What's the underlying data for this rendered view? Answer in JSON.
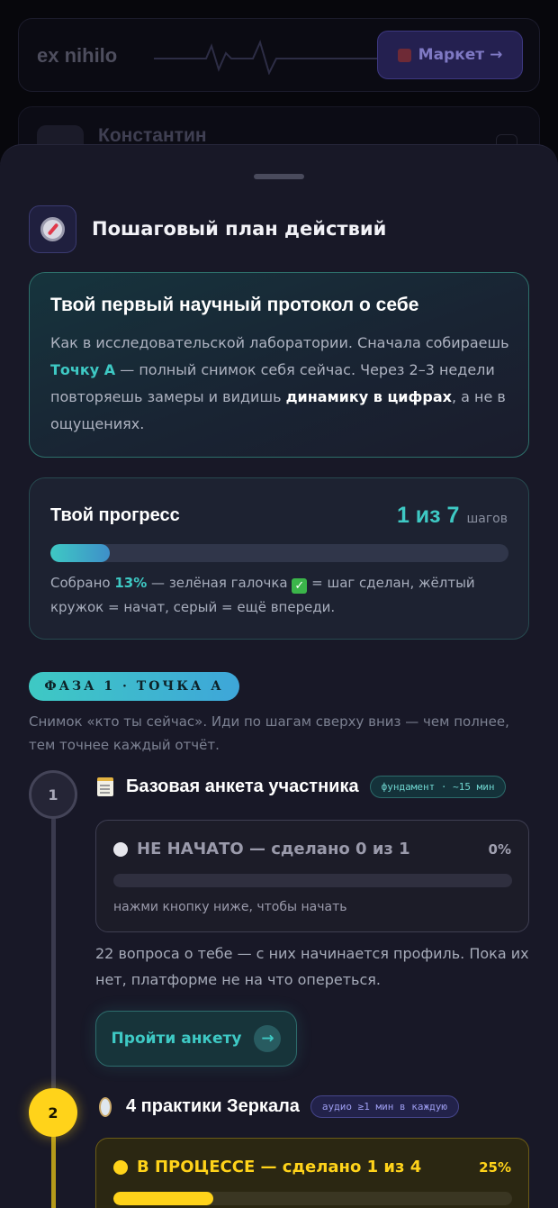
{
  "header": {
    "brand": "ex nihilo",
    "market_label": "Маркет →"
  },
  "profile": {
    "name": "Константин"
  },
  "sheet": {
    "title": "Пошаговый план действий",
    "intro": {
      "title": "Твой первый научный протокол о себе",
      "text_1": "Как в исследовательской лаборатории. Сначала собираешь ",
      "hl_1": "Точку А",
      "text_2": " — полный снимок себя сейчас. Через 2–3 недели повторяешь замеры и видишь ",
      "hl_2": "динамику в цифрах",
      "text_3": ", а не в ощущениях."
    },
    "progress": {
      "title": "Твой прогресс",
      "count": "1 из 7",
      "count_unit": "шагов",
      "fraction": 0.13,
      "note_1": "Собрано ",
      "note_pct": "13%",
      "note_2": " — зелёная галочка ",
      "note_check": "✓",
      "note_3": " = шаг сделан, жёлтый кружок = начат, серый = ещё впереди."
    },
    "phase": {
      "badge": "ФАЗА 1 · ТОЧКА А",
      "description": "Снимок «кто ты сейчас». Иди по шагам сверху вниз — чем полнее, тем точнее каждый отчёт."
    },
    "steps": [
      {
        "number": "1",
        "title": "Базовая анкета участника",
        "tag": "фундамент · ~15 мин",
        "status": "НЕ НАЧАТО — сделано 0 из 1",
        "percent": "0%",
        "fraction": 0,
        "hint": "нажми кнопку ниже, чтобы начать",
        "description": "22 вопроса о тебе — с них начинается профиль. Пока их нет, платформе не на что опереться.",
        "button": "Пройти анкету",
        "button_arrow": "→"
      },
      {
        "number": "2",
        "title": "4 практики Зеркала",
        "tag": "аудио ≥1 мин в каждую",
        "status": "В ПРОЦЕССЕ — сделано 1 из 4",
        "percent": "25%",
        "fraction": 0.25
      }
    ]
  },
  "colors": {
    "accent": "#3ec9c4",
    "in_progress": "#ffd31a",
    "sheet_bg": "#181827"
  }
}
